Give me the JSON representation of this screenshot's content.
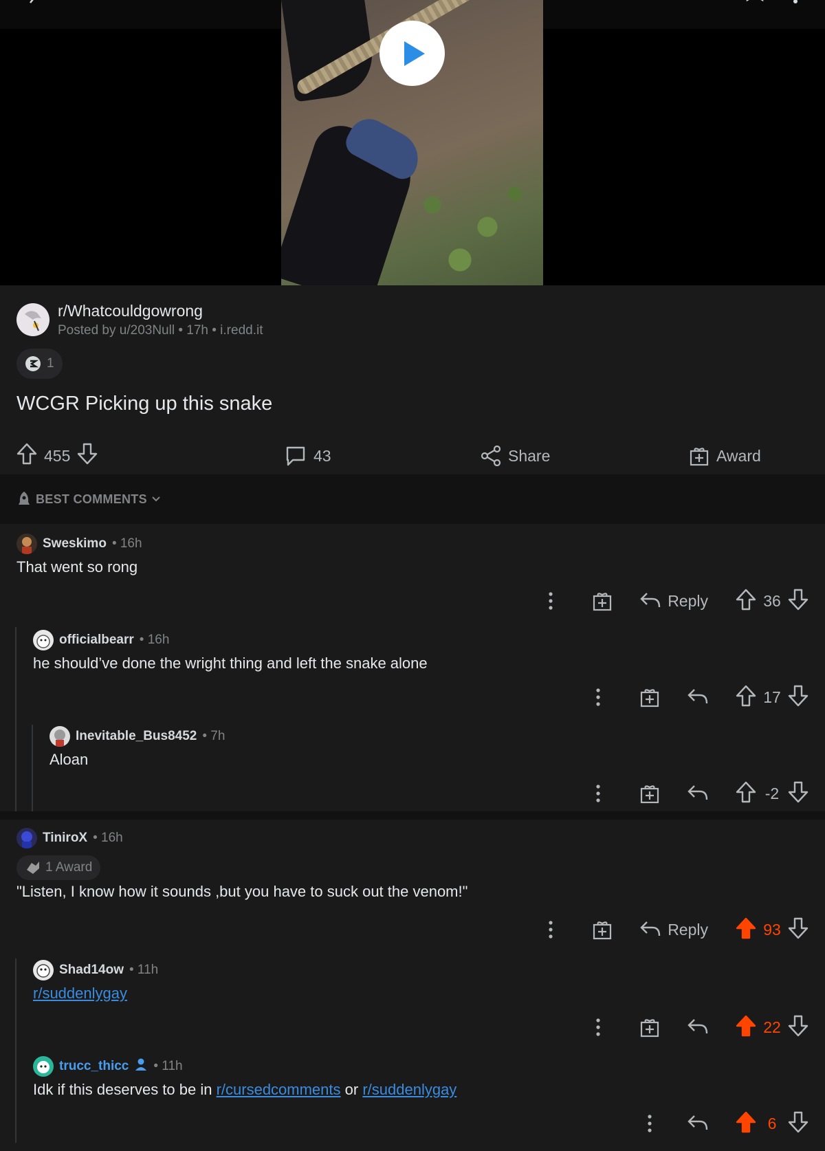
{
  "post": {
    "subreddit": "r/Whatcouldgowrong",
    "meta": "Posted by u/203Null • 17h • i.redd.it",
    "award_count": "1",
    "title": "WCGR Picking up this snake",
    "votes": "455",
    "comments": "43",
    "share_label": "Share",
    "award_label": "Award"
  },
  "sort": {
    "label": "BEST COMMENTS"
  },
  "comments": [
    {
      "user": "Sweskimo",
      "time": "• 16h",
      "body": "That went so rong",
      "reply_label": "Reply",
      "score": "36"
    },
    {
      "user": "officialbearr",
      "time": "• 16h",
      "body": "he should’ve done the wright thing and left the snake alone",
      "score": "17"
    },
    {
      "user": "Inevitable_Bus8452",
      "time": "• 7h",
      "body": "Aloan",
      "score": "-2"
    },
    {
      "user": "TiniroX",
      "time": "• 16h",
      "award_chip": "1 Award",
      "body": "\"Listen, I know how it sounds ,but you have to suck out the venom!\"",
      "reply_label": "Reply",
      "score": "93"
    },
    {
      "user": "Shad14ow",
      "time": "• 11h",
      "link": "r/suddenlygay",
      "score": "22"
    },
    {
      "user": "trucc_thicc",
      "time": "• 11h",
      "body_prefix": "Idk if this deserves to be in ",
      "link1": "r/cursedcomments",
      "body_mid": " or ",
      "link2": "r/suddenlygay",
      "score": "6"
    }
  ],
  "colors": {
    "upvote_active": "#ff4500",
    "link": "#3a8ce0",
    "op_blue": "#4a9ded"
  }
}
